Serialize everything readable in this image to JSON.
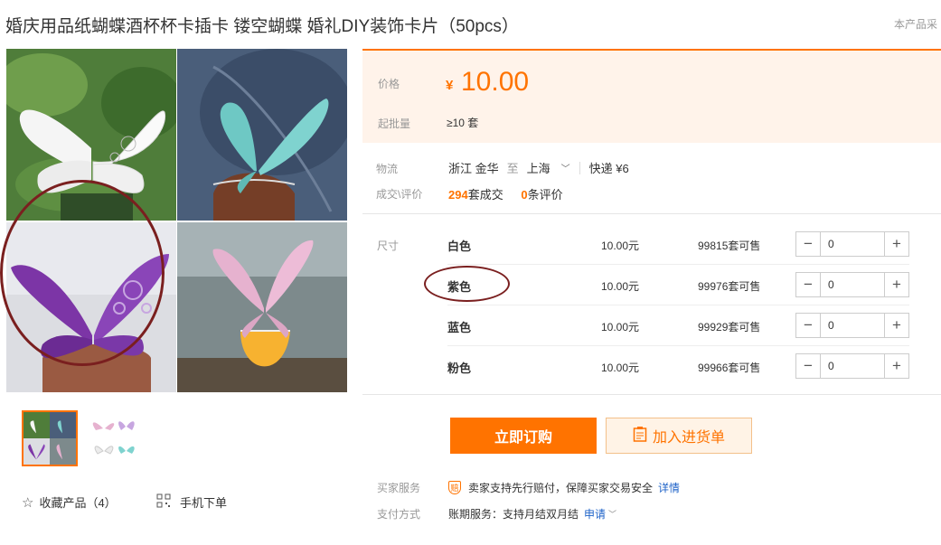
{
  "product": {
    "title": "婚庆用品纸蝴蝶酒杯杯卡插卡 镂空蝴蝶 婚礼DIY装饰卡片（50pcs）",
    "top_note": "本产品采"
  },
  "price": {
    "label": "价格",
    "currency": "¥",
    "value": "10.00",
    "moq_label": "起批量",
    "moq_value": "≥10 套"
  },
  "logistics": {
    "label": "物流",
    "from": "浙江 金华",
    "to_word": "至",
    "to": "上海",
    "shipping": "快递 ¥6"
  },
  "deals": {
    "label": "成交\\评价",
    "sold_count": "294",
    "sold_unit": "套成交",
    "review_count": "0",
    "review_unit": "条评价"
  },
  "sku": {
    "label": "尺寸",
    "rows": [
      {
        "name": "白色",
        "price": "10.00元",
        "stock": "99815套可售",
        "qty": "0"
      },
      {
        "name": "紫色",
        "price": "10.00元",
        "stock": "99976套可售",
        "qty": "0"
      },
      {
        "name": "蓝色",
        "price": "10.00元",
        "stock": "99929套可售",
        "qty": "0"
      },
      {
        "name": "粉色",
        "price": "10.00元",
        "stock": "99966套可售",
        "qty": "0"
      }
    ]
  },
  "actions": {
    "order": "立即订购",
    "cart": "加入进货单"
  },
  "services": {
    "buyer_label": "买家服务",
    "buyer_text": "卖家支持先行赔付，保障买家交易安全",
    "buyer_link": "详情",
    "pay_label": "支付方式",
    "pay_text": "账期服务：支持月结双月结",
    "pay_link": "申请"
  },
  "left": {
    "favorite": "收藏产品（4）",
    "mobile": "手机下单"
  },
  "colors": {
    "accent": "#ff7300",
    "link": "#1f63c8",
    "annotation": "#7a1f1f"
  }
}
